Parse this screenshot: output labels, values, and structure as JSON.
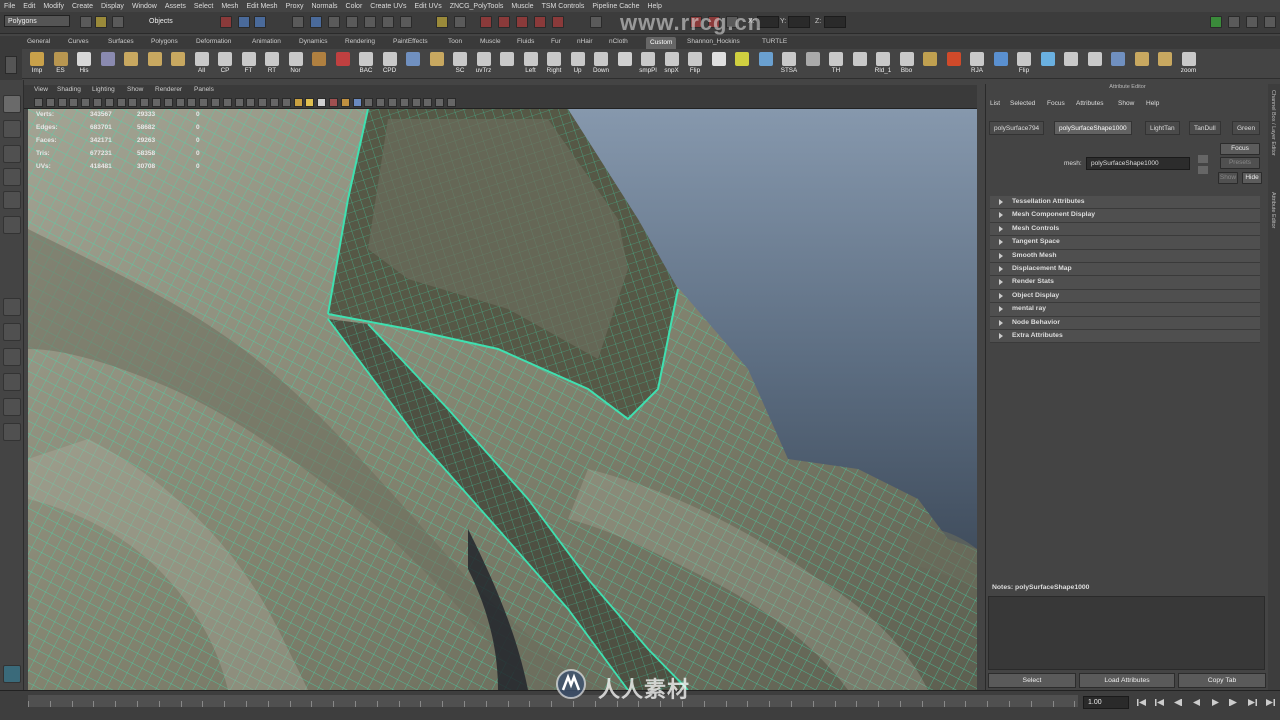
{
  "menubar": [
    "File",
    "Edit",
    "Modify",
    "Create",
    "Display",
    "Window",
    "Assets",
    "Select",
    "Mesh",
    "Edit Mesh",
    "Proxy",
    "Normals",
    "Color",
    "Create UVs",
    "Edit UVs",
    "ZNCG_PolyTools",
    "Muscle",
    "TSM Controls",
    "Pipeline Cache",
    "Help"
  ],
  "status": {
    "mode": "Polygons",
    "selection_mode": "Objects",
    "x_label": "X:",
    "y_label": "Y:",
    "z_label": "Z:"
  },
  "shelf_tabs": [
    "General",
    "Curves",
    "Surfaces",
    "Polygons",
    "Deformation",
    "Animation",
    "Dynamics",
    "Rendering",
    "PaintEffects",
    "Toon",
    "Muscle",
    "Fluids",
    "Fur",
    "nHair",
    "nCloth",
    "Custom",
    "Shannon_Hockins",
    "TURTLE"
  ],
  "shelf_active": "Custom",
  "shelf_buttons": [
    {
      "label": "Imp",
      "color": "#c9a14a"
    },
    {
      "label": "ES",
      "color": "#b89650"
    },
    {
      "label": "His",
      "color": "#d8d8d8"
    },
    {
      "label": "",
      "color": "#8a8ab0"
    },
    {
      "label": "",
      "color": "#c8a860"
    },
    {
      "label": "",
      "color": "#c8a860"
    },
    {
      "label": "",
      "color": "#c8a860"
    },
    {
      "label": "All",
      "color": "#c9c9c9"
    },
    {
      "label": "CP",
      "color": "#c9c9c9"
    },
    {
      "label": "FT",
      "color": "#c9c9c9"
    },
    {
      "label": "RT",
      "color": "#c9c9c9"
    },
    {
      "label": "Nor",
      "color": "#c9c9c9"
    },
    {
      "label": "",
      "color": "#b08040"
    },
    {
      "label": "",
      "color": "#c04040"
    },
    {
      "label": "BAC",
      "color": "#c9c9c9"
    },
    {
      "label": "CPD",
      "color": "#c9c9c9"
    },
    {
      "label": "",
      "color": "#7090c0"
    },
    {
      "label": "",
      "color": "#c8a860"
    },
    {
      "label": "SC",
      "color": "#c9c9c9"
    },
    {
      "label": "uvTrz",
      "color": "#c9c9c9"
    },
    {
      "label": "",
      "color": "#c9c9c9"
    },
    {
      "label": "Left",
      "color": "#c9c9c9"
    },
    {
      "label": "Right",
      "color": "#c9c9c9"
    },
    {
      "label": "Up",
      "color": "#c9c9c9"
    },
    {
      "label": "Down",
      "color": "#c9c9c9"
    },
    {
      "label": "",
      "color": "#d0d0d0"
    },
    {
      "label": "smpPl",
      "color": "#c9c9c9"
    },
    {
      "label": "snpX",
      "color": "#c9c9c9"
    },
    {
      "label": "Flip",
      "color": "#c9c9c9"
    },
    {
      "label": "",
      "color": "#e0e0e0"
    },
    {
      "label": "",
      "color": "#d0d040"
    },
    {
      "label": "",
      "color": "#6aa0d0"
    },
    {
      "label": "STSA",
      "color": "#c9c9c9"
    },
    {
      "label": "",
      "color": "#aaaaaa"
    },
    {
      "label": "TH",
      "color": "#c9c9c9"
    },
    {
      "label": "",
      "color": "#c9c9c9"
    },
    {
      "label": "Rld_1",
      "color": "#c9c9c9"
    },
    {
      "label": "Bbo",
      "color": "#c9c9c9"
    },
    {
      "label": "",
      "color": "#c0a050"
    },
    {
      "label": "",
      "color": "#d04a2a"
    },
    {
      "label": "RJA",
      "color": "#c9c9c9"
    },
    {
      "label": "",
      "color": "#5a90d0"
    },
    {
      "label": "Flip",
      "color": "#c9c9c9"
    },
    {
      "label": "",
      "color": "#6ab0e0"
    },
    {
      "label": "",
      "color": "#c9c9c9"
    },
    {
      "label": "",
      "color": "#c9c9c9"
    },
    {
      "label": "",
      "color": "#7090c0"
    },
    {
      "label": "",
      "color": "#c8a860"
    },
    {
      "label": "",
      "color": "#c8a860"
    },
    {
      "label": "zoom",
      "color": "#c9c9c9"
    }
  ],
  "viewport_menu": [
    "View",
    "Shading",
    "Lighting",
    "Show",
    "Renderer",
    "Panels"
  ],
  "hud": {
    "rows": [
      {
        "key": "Verts:",
        "a": "343567",
        "b": "29333",
        "c": "0"
      },
      {
        "key": "Edges:",
        "a": "683701",
        "b": "58682",
        "c": "0"
      },
      {
        "key": "Faces:",
        "a": "342171",
        "b": "29263",
        "c": "0"
      },
      {
        "key": "Tris:",
        "a": "677231",
        "b": "58358",
        "c": "0"
      },
      {
        "key": "UVs:",
        "a": "418481",
        "b": "30708",
        "c": "0"
      }
    ]
  },
  "viewport_colors": {
    "wire": "#3fe0b0",
    "surface": "#8a8a7c",
    "bg_top": "#8698ad",
    "bg_bottom": "#2c3643"
  },
  "attribute_editor": {
    "title": "Attribute Editor",
    "menu": [
      "List",
      "Selected",
      "Focus",
      "Attributes",
      "Show",
      "Help"
    ],
    "tabs": [
      "polySurface794",
      "polySurfaceShape1000",
      "LightTan",
      "TanDull",
      "Green"
    ],
    "active_tab": "polySurfaceShape1000",
    "mesh_label": "mesh:",
    "mesh_value": "polySurfaceShape1000",
    "focus_label": "Focus",
    "presets_label": "Presets",
    "show_label": "Show",
    "hide_label": "Hide",
    "sections": [
      "Tessellation Attributes",
      "Mesh Component Display",
      "Mesh Controls",
      "Tangent Space",
      "Smooth Mesh",
      "Displacement Map",
      "Render Stats",
      "Object Display",
      "mental ray",
      "Node Behavior",
      "Extra Attributes"
    ],
    "notes_label": "Notes:  polySurfaceShape1000",
    "buttons": {
      "select": "Select",
      "load": "Load Attributes",
      "copy": "Copy Tab"
    }
  },
  "side_tabs": {
    "top": "Channel Box / Layer Editor",
    "bottom": "Attribute Editor"
  },
  "timeline": {
    "frame": "1.00"
  },
  "watermark": {
    "top": "www.rrcg.cn",
    "bottom": "人人素材"
  }
}
